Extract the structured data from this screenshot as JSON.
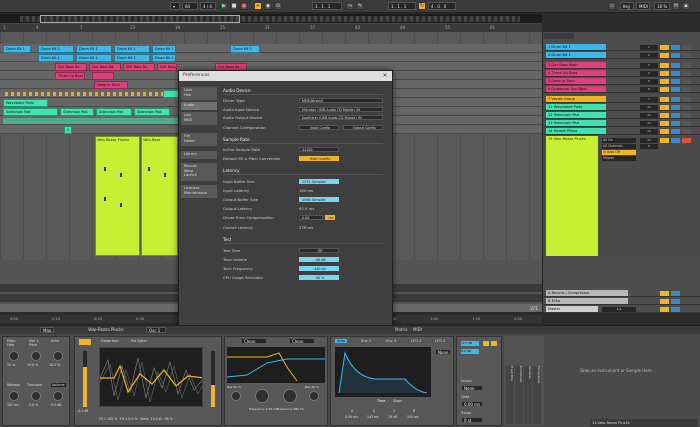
{
  "transport": {
    "tempo": "64",
    "meter": "4 / 4",
    "position": "3 . 1 . 1",
    "loop_start": "1 . 1 . 1",
    "loop_length": "4 . 0 . 0",
    "key_label": "Key",
    "midi_label": "MIDI",
    "cpu": "18 %",
    "play_glyph": "▶",
    "stop_glyph": "■",
    "record_glyph": "●"
  },
  "arrangement": {
    "ruler": [
      "1",
      "4",
      "7",
      "13",
      "19",
      "25",
      "31",
      "37",
      "43",
      "49",
      "55",
      "61"
    ],
    "clips": {
      "drum_kit": "Drum Kit 1",
      "dirt_bass": "Dirt Bass Ra",
      "three_up": "Three Up Bass",
      "deep_dark": "Deep in Dark",
      "sidechain": "Sidechain Pad",
      "wavetable": "Wavetable Pads",
      "velo_1": "Velo-Rezzo Plucks",
      "velo_2": "Velo-Rezz",
      "c_marker": "C"
    },
    "time_ruler": [
      "0:00",
      "0:10",
      "0:20",
      "0:30",
      "0:40",
      "0:50",
      "1:00",
      "1:10",
      "1:20",
      "1:30",
      "1:40",
      "1:50",
      "2:00"
    ],
    "zoom_label": "2/1"
  },
  "tracks": [
    {
      "name": "1 Drum Kit 1",
      "color": "#3fb6e6",
      "vol": "0",
      "num": "1"
    },
    {
      "name": "2 Drum Kit 1",
      "color": "#3fb6e6",
      "vol": "0",
      "num": "2"
    },
    {
      "name": "3 Dirt Bass Rash",
      "color": "#e0407a",
      "vol": "0",
      "num": "3"
    },
    {
      "name": "4 Three Up Bass",
      "color": "#e0407a",
      "vol": "0",
      "num": "4"
    },
    {
      "name": "5 Deep in Dark",
      "color": "#e0407a",
      "vol": "0",
      "num": "5"
    },
    {
      "name": "6 Grossover Syn Bass",
      "color": "#e0407a",
      "vol": "0",
      "num": "6"
    },
    {
      "name": "7 Vocals Group",
      "color": "#f0b429",
      "vol": "0",
      "num": "7"
    },
    {
      "name": "11 Wavetable Pads",
      "color": "#3ee3b0",
      "vol": "0",
      "num": "11"
    },
    {
      "name": "12 Sidechain Pad",
      "color": "#3ee3b0",
      "vol": "0",
      "num": "12"
    },
    {
      "name": "13 Sidechain Pad",
      "color": "#3ee3b0",
      "vol": "0",
      "num": "13"
    },
    {
      "name": "14 Hornet Pillow",
      "color": "#3ee3b0",
      "vol": "0",
      "num": "14"
    },
    {
      "name": "15 Velo-Rezzo Plucks",
      "color": "#c6f032",
      "vol": "0",
      "num": "15"
    }
  ],
  "track_io": {
    "all_ins": "All Ins",
    "all_channels": "All Channels",
    "in_auto_off": "In Auto Off",
    "master_label": "Master",
    "val_1": "13",
    "val_2": "0"
  },
  "returns": [
    {
      "name": "A Reverb | Compressor",
      "color": "#b8b8b8"
    },
    {
      "name": "B Echo",
      "color": "#b8b8b8"
    },
    {
      "name": "Master",
      "color": "#d0d0d0"
    }
  ],
  "prefs": {
    "title": "Preferences",
    "close_glyph": "×",
    "tabs": [
      "Look\nFeel",
      "Audio",
      "Link\nMIDI",
      "File\nFolder",
      "Library",
      "Record\nWarp\nLaunch",
      "Licenses\nMaintenance"
    ],
    "audio_device": {
      "heading": "Audio Device",
      "driver_type_label": "Driver Type",
      "driver_type": "MME/DirectX",
      "input_device_label": "Audio Input Device",
      "input_device": "Mikrofon (USB Audio CD Mobile) (M",
      "output_device_label": "Audio Output Device",
      "output_device": "Kopfhörer (USB Audio CD Mobile) (M",
      "channel_config_label": "Channel Configuration",
      "input_config": "Input Config",
      "output_config": "Output Config"
    },
    "sample_rate": {
      "heading": "Sample Rate",
      "in_out_label": "In/Out Sample Rate",
      "in_out": "44100",
      "pitch_label": "Default SR & Pitch Conversion",
      "pitch": "High Quality"
    },
    "latency": {
      "heading": "Latency",
      "input_buffer_label": "Input Buffer Size",
      "input_buffer": "2272 Samples",
      "input_latency_label": "Input Latency",
      "input_latency": "160 ms",
      "output_buffer_label": "Output Buffer Size",
      "output_buffer": "4096 Samples",
      "output_latency_label": "Output Latency",
      "output_latency": "92.9 ms",
      "driver_comp_label": "Driver Error Compensation",
      "driver_comp": "0.00",
      "driver_comp_unit": "ms",
      "overall_label": "Overall Latency",
      "overall": "278 ms"
    },
    "test": {
      "heading": "Test",
      "tone_label": "Test Tone",
      "tone": "Off",
      "volume_label": "Tone Volume",
      "volume": "-36 dB",
      "freq_label": "Tone Frequency",
      "freq": "440 Hz",
      "cpu_label": "CPU Usage Simulator",
      "cpu": "50 %"
    }
  },
  "device": {
    "track_title": "Velo-Rezzo Plucks",
    "map_label": "Map",
    "tabs": [
      "Osc 1",
      "Osc 2",
      "Sub",
      "Filter 1",
      "Matrix",
      "MIDI"
    ],
    "macros": [
      "Filter Freq",
      "Osc 2 Pitch",
      "Echo",
      "Release",
      "Transient",
      "Volume"
    ],
    "macro_values": [
      "31 %",
      "19.0 %",
      "26.2 %",
      "182 ms",
      "0.0 %",
      "0.0 dB"
    ],
    "osc_header": "Distortion",
    "osc_wave": "Pal Bitter",
    "osc_readout": "FX 1 100 % · FX 2 0.0 % · Semi -12.0 st · 38 %",
    "osc_gain": "-0.2 dB",
    "filter_type": "Clean",
    "filter_type_2": "Clean",
    "filter_values": [
      "Res 50 %",
      "Frequency 1.00 kHz",
      "Frequency 986 Hz",
      "Res 40 %"
    ],
    "env_tabs": [
      "Amp",
      "Env 2",
      "Env 3",
      "LFO 1",
      "LFO 2"
    ],
    "env_time": "Time",
    "env_slope": "Slope",
    "env_values": [
      "0.00 ms",
      "143 ms",
      "-19 dB",
      "100 ms"
    ],
    "env_labels": [
      "A",
      "D",
      "S",
      "R"
    ],
    "env_none": "None",
    "global_vals": [
      "-4.7 dB",
      "0.0 dB"
    ],
    "voice_labels": [
      "Unison",
      "Glide",
      "Transp."
    ],
    "voice_vals": [
      "None",
      "0.00 ms",
      "0 st"
    ],
    "rack_labels": [
      "Fixed Pots",
      "Knoblocker",
      "Schatten",
      "Kompressor"
    ],
    "drop_text": "Drop an Instrument or Sample Here",
    "status_track": "15-Velo-Rezzo Plucks"
  }
}
